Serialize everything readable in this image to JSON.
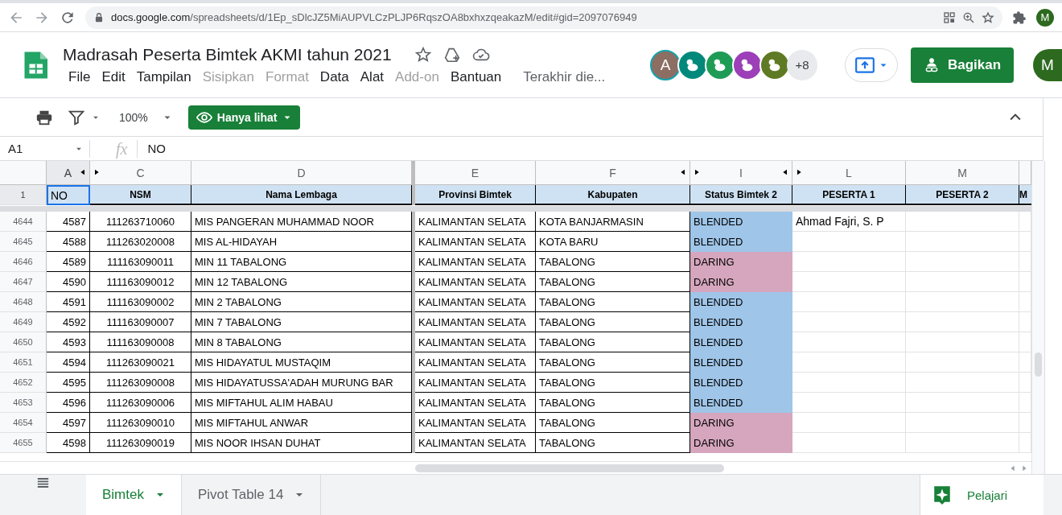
{
  "browser": {
    "url_host": "docs.google.com",
    "url_path": "/spreadsheets/d/1Ep_sDlcJZ5MiAUPVLCzPLJP6RqszOA8bxhxzqeakazM/edit#gid=2097076949",
    "profile": "M"
  },
  "document": {
    "title": "Madrasah Peserta Bimtek AKMI tahun 2021",
    "menu": [
      {
        "label": "File",
        "disabled": false
      },
      {
        "label": "Edit",
        "disabled": false
      },
      {
        "label": "Tampilan",
        "disabled": false
      },
      {
        "label": "Sisipkan",
        "disabled": true
      },
      {
        "label": "Format",
        "disabled": true
      },
      {
        "label": "Data",
        "disabled": false
      },
      {
        "label": "Alat",
        "disabled": false
      },
      {
        "label": "Add-on",
        "disabled": true
      },
      {
        "label": "Bantuan",
        "disabled": false
      }
    ],
    "last_edit": "Terakhir die...",
    "collaborators": [
      {
        "kind": "letter",
        "label": "A",
        "color": "#8d6e63"
      },
      {
        "kind": "animal",
        "color": "#00897b"
      },
      {
        "kind": "animal",
        "color": "#1e9c55"
      },
      {
        "kind": "animal",
        "color": "#9c3fb8"
      },
      {
        "kind": "animal",
        "color": "#5f7a24"
      }
    ],
    "more_collaborators": "+8",
    "share_button": "Bagikan",
    "account": "M"
  },
  "toolbar": {
    "zoom": "100%",
    "mode_button": "Hanya lihat"
  },
  "formula_bar": {
    "cell_ref": "A1",
    "function_label": "fx",
    "value": "NO"
  },
  "columns": [
    {
      "letter": "A",
      "selected": true,
      "hidden_after": true
    },
    {
      "letter": "C",
      "selected": false,
      "hidden_after": false
    },
    {
      "letter": "D",
      "selected": false,
      "hidden_after": false
    },
    {
      "letter": "E",
      "selected": false,
      "hidden_after": false
    },
    {
      "letter": "F",
      "selected": false,
      "hidden_after": true
    },
    {
      "letter": "I",
      "selected": false,
      "hidden_after": true
    },
    {
      "letter": "L",
      "selected": false,
      "hidden_after": false
    },
    {
      "letter": "M",
      "selected": false,
      "hidden_after": false
    }
  ],
  "header_row": {
    "number": "1",
    "selected": true,
    "cells": [
      "NO",
      "NSM",
      "Nama Lembaga",
      "Provinsi Bimtek",
      "Kabupaten",
      "Status Bimtek 2",
      "PESERTA 1",
      "PESERTA 2",
      "M"
    ]
  },
  "rows": [
    {
      "number": "4644",
      "no": "4587",
      "nsm": "111263710060",
      "name": "MIS PANGERAN MUHAMMAD NOOR",
      "province": "KALIMANTAN SELATA",
      "regency": "KOTA BANJARMASIN",
      "status": {
        "label": "BLENDED",
        "color": "#9fc5e8"
      },
      "peserta_1": "Ahmad Fajri, S. P"
    },
    {
      "number": "4645",
      "no": "4588",
      "nsm": "111263020008",
      "name": "MIS AL-HIDAYAH",
      "province": "KALIMANTAN SELATA",
      "regency": "KOTA BARU",
      "status": {
        "label": "BLENDED",
        "color": "#9fc5e8"
      }
    },
    {
      "number": "4646",
      "no": "4589",
      "nsm": "111163090011",
      "name": "MIN 11 TABALONG",
      "province": "KALIMANTAN SELATA",
      "regency": "TABALONG",
      "status": {
        "label": "DARING",
        "color": "#d5a6bd"
      }
    },
    {
      "number": "4647",
      "no": "4590",
      "nsm": "111163090012",
      "name": "MIN 12 TABALONG",
      "province": "KALIMANTAN SELATA",
      "regency": "TABALONG",
      "status": {
        "label": "DARING",
        "color": "#d5a6bd"
      }
    },
    {
      "number": "4648",
      "no": "4591",
      "nsm": "111163090002",
      "name": "MIN 2 TABALONG",
      "province": "KALIMANTAN SELATA",
      "regency": "TABALONG",
      "status": {
        "label": "BLENDED",
        "color": "#9fc5e8"
      }
    },
    {
      "number": "4649",
      "no": "4592",
      "nsm": "111163090007",
      "name": "MIN 7 TABALONG",
      "province": "KALIMANTAN SELATA",
      "regency": "TABALONG",
      "status": {
        "label": "BLENDED",
        "color": "#9fc5e8"
      }
    },
    {
      "number": "4650",
      "no": "4593",
      "nsm": "111163090008",
      "name": "MIN 8 TABALONG",
      "province": "KALIMANTAN SELATA",
      "regency": "TABALONG",
      "status": {
        "label": "BLENDED",
        "color": "#9fc5e8"
      }
    },
    {
      "number": "4651",
      "no": "4594",
      "nsm": "111263090021",
      "name": "MIS HIDAYATUL MUSTAQIM",
      "province": "KALIMANTAN SELATA",
      "regency": "TABALONG",
      "status": {
        "label": "BLENDED",
        "color": "#9fc5e8"
      }
    },
    {
      "number": "4652",
      "no": "4595",
      "nsm": "111263090008",
      "name": "MIS HIDAYATUSSA'ADAH MURUNG BAR",
      "province": "KALIMANTAN SELATA",
      "regency": "TABALONG",
      "status": {
        "label": "BLENDED",
        "color": "#9fc5e8"
      }
    },
    {
      "number": "4653",
      "no": "4596",
      "nsm": "111263090006",
      "name": "MIS MIFTAHUL ALIM HABAU",
      "province": "KALIMANTAN SELATA",
      "regency": "TABALONG",
      "status": {
        "label": "BLENDED",
        "color": "#9fc5e8"
      }
    },
    {
      "number": "4654",
      "no": "4597",
      "nsm": "111263090010",
      "name": "MIS MIFTAHUL ANWAR",
      "province": "KALIMANTAN SELATA",
      "regency": "TABALONG",
      "status": {
        "label": "DARING",
        "color": "#d5a6bd"
      }
    },
    {
      "number": "4655",
      "no": "4598",
      "nsm": "111263090019",
      "name": "MIS NOOR IHSAN DUHAT",
      "province": "KALIMANTAN SELATA",
      "regency": "TABALONG",
      "status": {
        "label": "DARING",
        "color": "#d5a6bd"
      }
    }
  ],
  "sheet_tabs": [
    {
      "label": "Bimtek",
      "selected": true
    },
    {
      "label": "Pivot Table 14",
      "selected": false
    }
  ],
  "explore_button": "Pelajari"
}
